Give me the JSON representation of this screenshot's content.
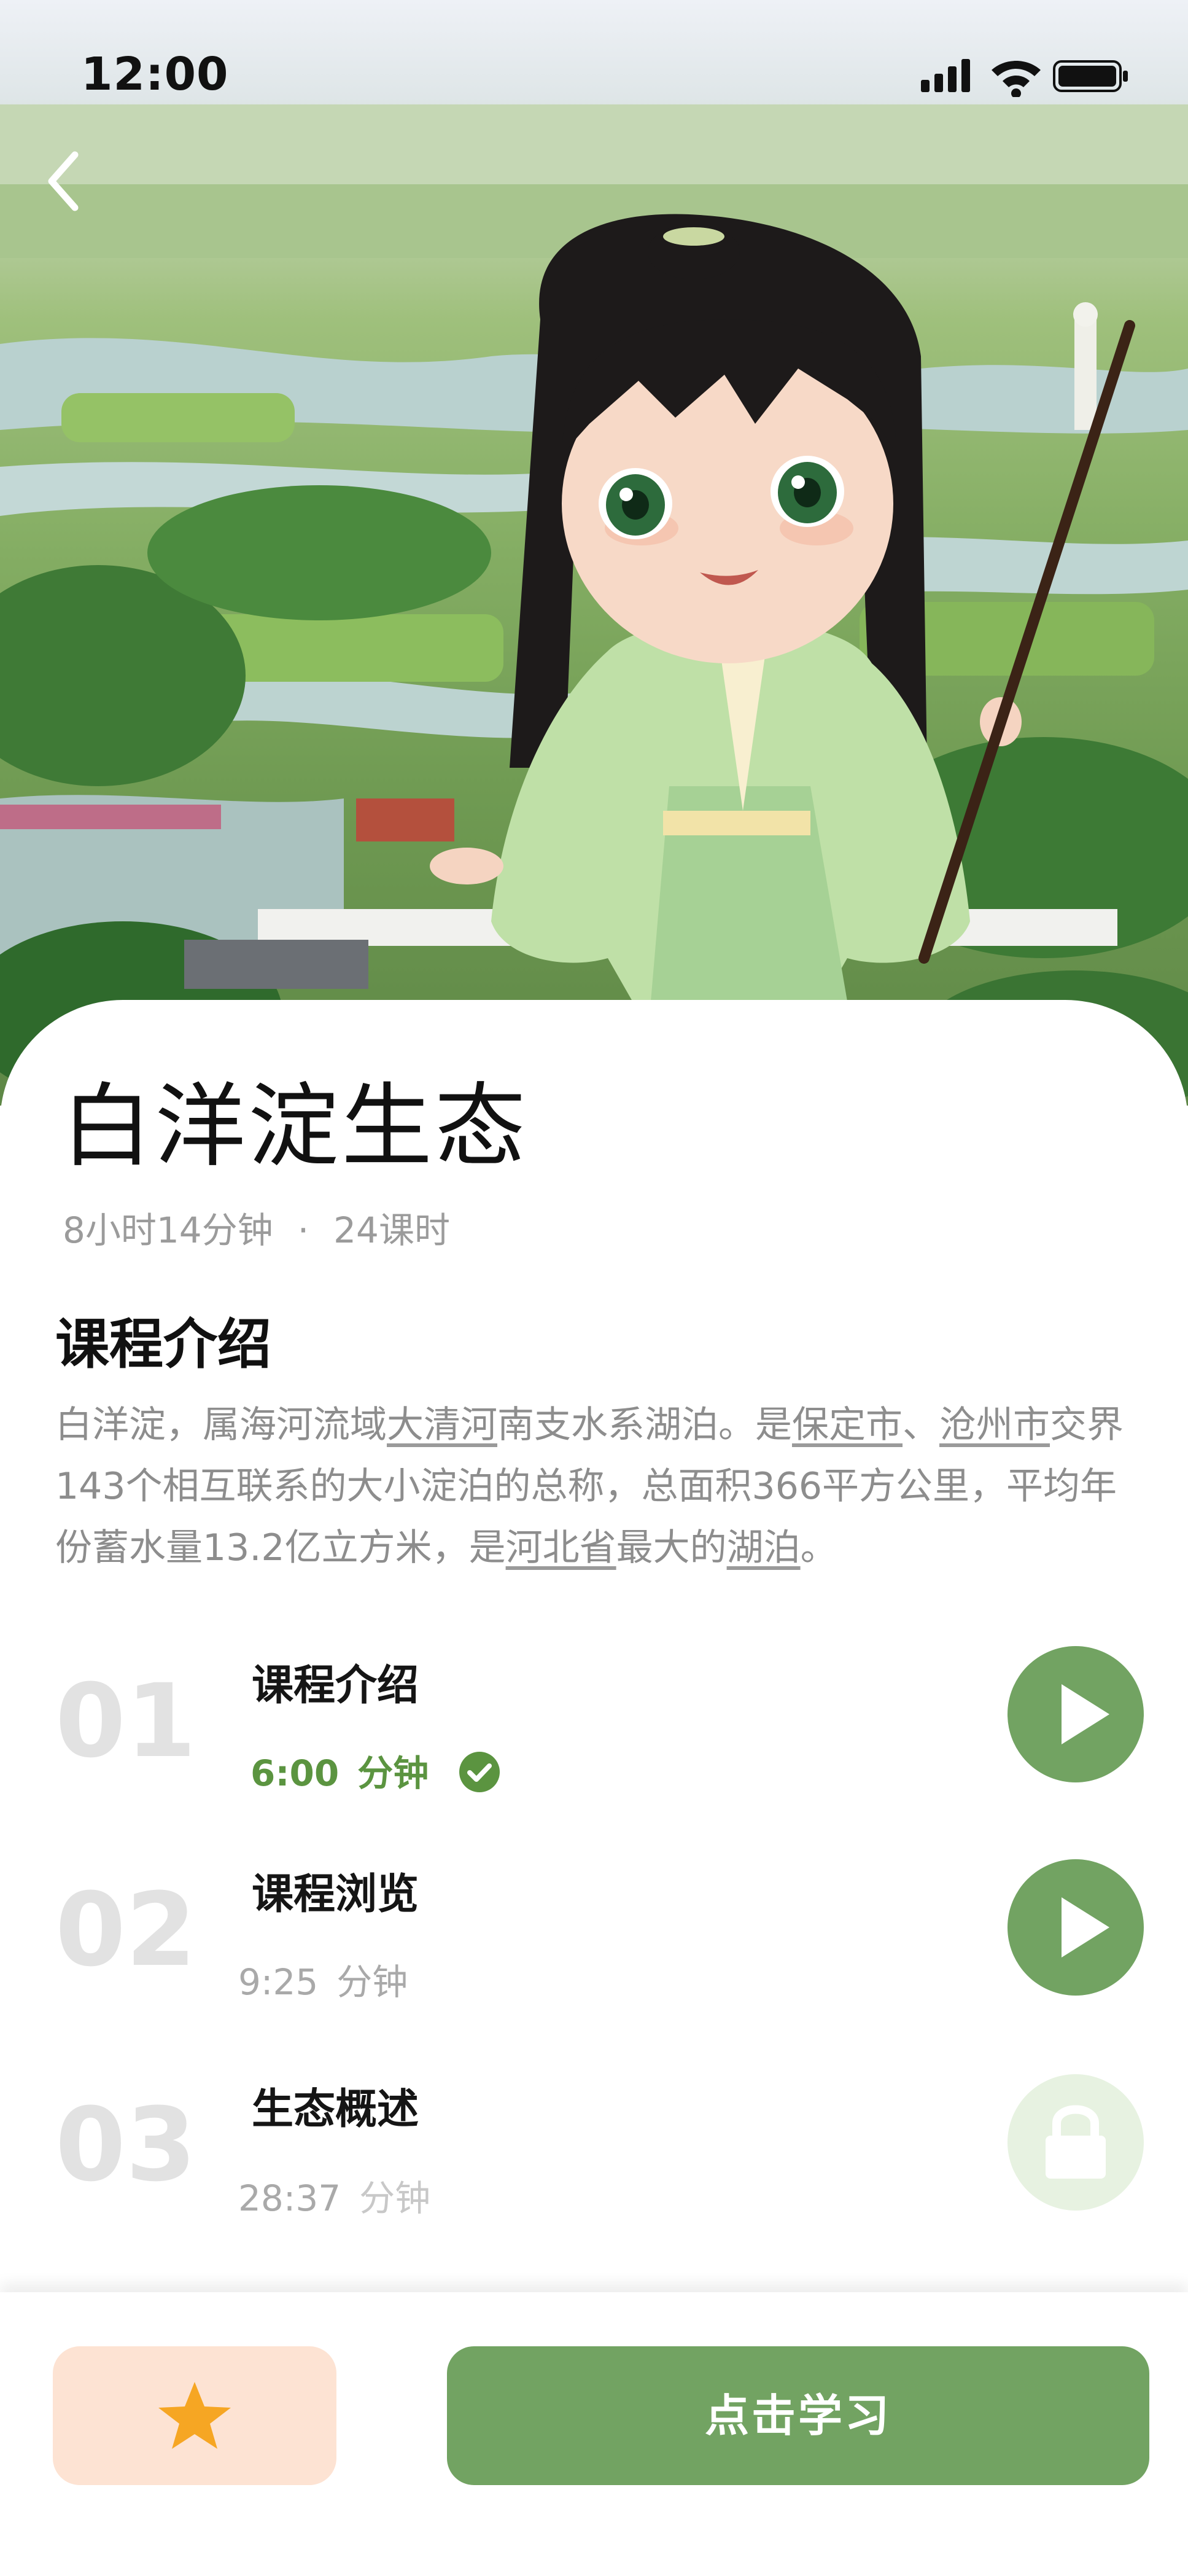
{
  "status_bar": {
    "time": "12:00",
    "icons": [
      "signal-icon",
      "wifi-icon",
      "battery-icon"
    ]
  },
  "nav": {
    "back_icon": "chevron-left-icon"
  },
  "course": {
    "title": "白洋淀生态",
    "duration": "8小时14分钟",
    "separator": "·",
    "lessons_count": "24课时"
  },
  "intro": {
    "heading": "课程介绍",
    "parts": [
      {
        "text": "白洋淀，属海河流域",
        "link": false
      },
      {
        "text": "大清河",
        "link": true
      },
      {
        "text": "南支水系湖泊。是",
        "link": false
      },
      {
        "text": "保定市",
        "link": true
      },
      {
        "text": "、",
        "link": false
      },
      {
        "text": "沧州市",
        "link": true
      },
      {
        "text": "交界143个相互联系的大小淀泊的总称，总面积366平方公里，平均年份蓄水量13.2亿立方米，是",
        "link": false
      },
      {
        "text": "河北省",
        "link": true
      },
      {
        "text": "最大的",
        "link": false
      },
      {
        "text": "湖泊",
        "link": true
      },
      {
        "text": "。",
        "link": false
      }
    ]
  },
  "lessons": [
    {
      "num": "01",
      "name": "课程介绍",
      "time": "6:00",
      "unit": "分钟",
      "state": "completed",
      "action_icon": "play-icon"
    },
    {
      "num": "02",
      "name": "课程浏览",
      "time": "9:25",
      "unit": "分钟",
      "state": "available",
      "action_icon": "play-icon"
    },
    {
      "num": "03",
      "name": "生态概述",
      "time": "28:37",
      "unit": "分钟",
      "state": "locked",
      "action_icon": "lock-icon"
    }
  ],
  "actions": {
    "favorite_icon": "star-icon",
    "study_label": "点击学习"
  },
  "colors": {
    "accent": "#72a362",
    "accent_text": "#5b9440",
    "fav_bg": "#fde3d3",
    "star": "#f6a623",
    "lock_bg": "#e7f2e1"
  }
}
